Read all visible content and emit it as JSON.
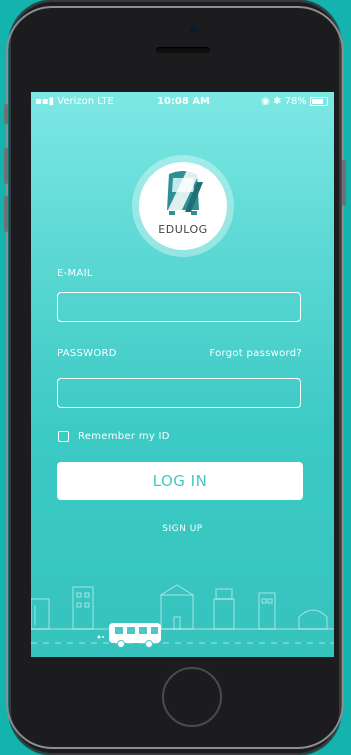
{
  "status_bar": {
    "carrier": "Verizon  LTE",
    "time": "10:08 AM",
    "indicators": "78%"
  },
  "logo": {
    "name": "EDULOG"
  },
  "form": {
    "email_label": "E-MAIL",
    "email_value": "",
    "password_label": "PASSWORD",
    "password_value": "",
    "forgot_link": "Forgot password?",
    "remember_label": "Remember my ID",
    "login_button": "LOG IN",
    "signup_link": "SIGN UP"
  },
  "colors": {
    "accent": "#45c8c3",
    "background": "#14b3ad"
  }
}
